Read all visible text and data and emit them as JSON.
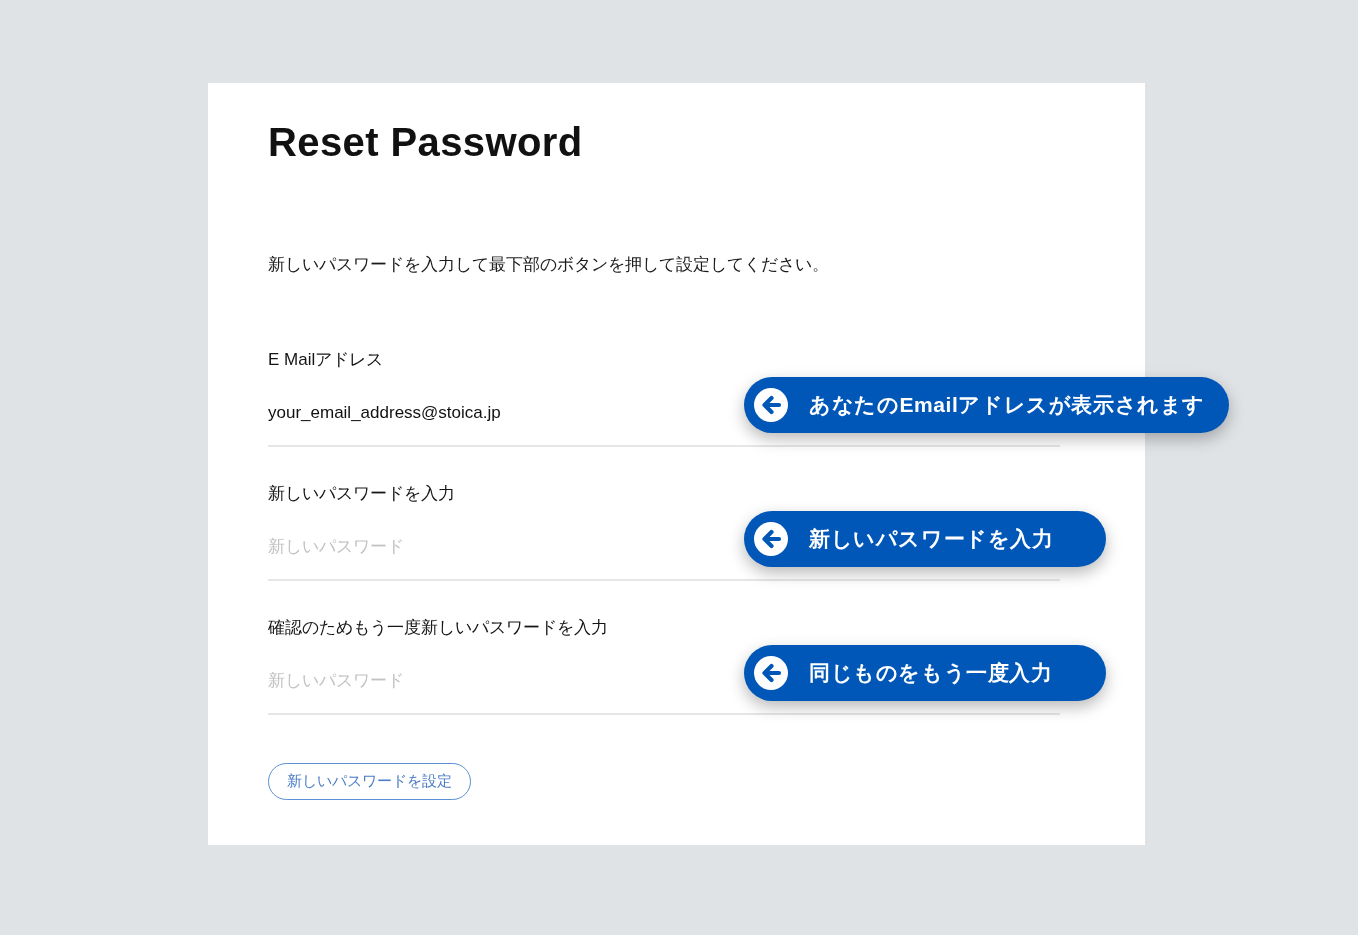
{
  "card": {
    "title": "Reset Password",
    "instruction": "新しいパスワードを入力して最下部のボタンを押して設定してください。",
    "fields": [
      {
        "label": "E Mailアドレス",
        "value": "your_email_address@stoica.jp",
        "callout": "あなたのEmailアドレスが表示されます"
      },
      {
        "label": "新しいパスワードを入力",
        "placeholder": "新しいパスワード",
        "callout": "新しいパスワードを入力"
      },
      {
        "label": "確認のためもう一度新しいパスワードを入力",
        "placeholder": "新しいパスワード",
        "callout": "同じものをもう一度入力"
      }
    ],
    "submit_button": "新しいパスワードを設定"
  }
}
